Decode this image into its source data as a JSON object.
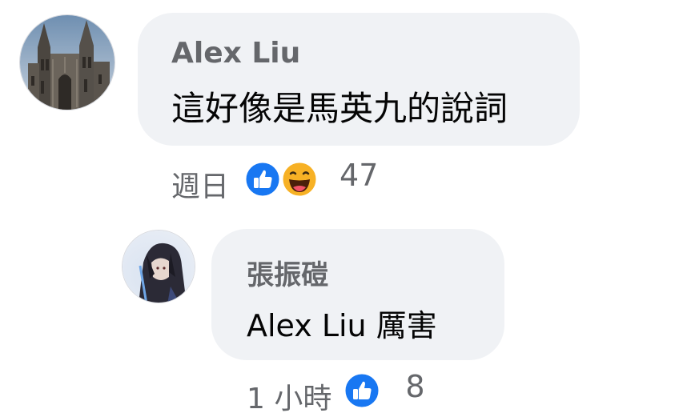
{
  "comments": [
    {
      "author": "Alex Liu",
      "text": "這好像是馬英九的說詞",
      "time": "週日",
      "reactions": [
        "like-icon",
        "haha-icon"
      ],
      "reaction_count": "47"
    },
    {
      "author": "張振磑",
      "text": "Alex Liu 厲害",
      "time": "1 小時",
      "reactions": [
        "like-icon"
      ],
      "reaction_count": "8"
    }
  ],
  "colors": {
    "like_blue": "#1877f2",
    "haha_yellow": "#f7b125",
    "bubble_bg": "#f0f2f5",
    "meta_gray": "#65676b"
  }
}
